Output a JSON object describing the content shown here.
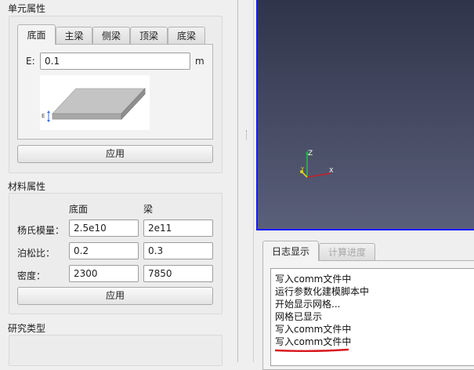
{
  "unit_props": {
    "title": "单元属性",
    "tabs": [
      "底面",
      "主梁",
      "侧梁",
      "顶梁",
      "底梁"
    ],
    "active_tab": "底面",
    "e_label": "E:",
    "e_value": "0.1",
    "unit": "m",
    "diagram_label": "E",
    "apply": "应用"
  },
  "material": {
    "title": "材料属性",
    "col_bottom": "底面",
    "col_beam": "梁",
    "rows": [
      {
        "label": "杨氏模量：",
        "bottom": "2.5e10",
        "beam": "2e11"
      },
      {
        "label": "泊松比：",
        "bottom": "0.2",
        "beam": "0.3"
      },
      {
        "label": "密度：",
        "bottom": "2300",
        "beam": "7850"
      }
    ],
    "apply": "应用"
  },
  "study": {
    "title": "研究类型"
  },
  "viewport": {
    "axis_z": "Z",
    "axis_x": "X",
    "axis_y": "Y",
    "bg_top": "#30344a",
    "bg_bottom": "#5a5f7a"
  },
  "log": {
    "tabs": [
      "日志显示",
      "计算进度"
    ],
    "active_tab": "日志显示",
    "lines": [
      "写入comm文件中",
      "运行参数化建模脚本中",
      "开始显示网格...",
      "网格已显示",
      "写入comm文件中",
      "写入comm文件中"
    ]
  },
  "colors": {
    "accent_underline": "#d8181e",
    "viewport_border": "#1a1aff"
  }
}
